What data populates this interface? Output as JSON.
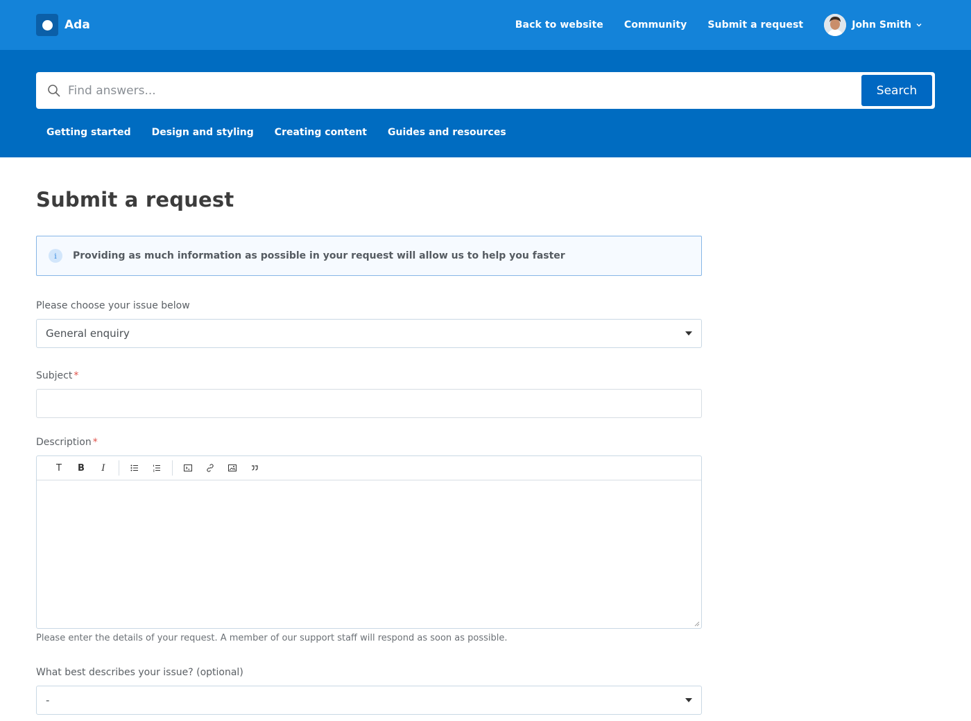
{
  "brand": {
    "name": "Ada"
  },
  "topnav": {
    "links": [
      "Back to website",
      "Community",
      "Submit a request"
    ],
    "user_name": "John Smith"
  },
  "search": {
    "placeholder": "Find answers...",
    "button_label": "Search"
  },
  "categories": [
    "Getting started",
    "Design and styling",
    "Creating content",
    "Guides and resources"
  ],
  "page": {
    "title": "Submit a request"
  },
  "notice": {
    "text": "Providing as much information as possible in your request will allow us to help you faster",
    "icon": "info-icon"
  },
  "form": {
    "issue": {
      "label": "Please choose your issue below",
      "value": "General enquiry"
    },
    "subject": {
      "label": "Subject",
      "required": "*",
      "value": ""
    },
    "description": {
      "label": "Description",
      "required": "*",
      "toolbar": [
        "text-icon",
        "bold-icon",
        "italic-icon",
        "bullet-list-icon",
        "numbered-list-icon",
        "code-block-icon",
        "link-icon",
        "image-icon",
        "quote-icon"
      ],
      "hint": "Please enter the details of your request. A member of our support staff will respond as soon as possible."
    },
    "issue_type": {
      "label": "What best describes your issue? (optional)",
      "value": "-"
    }
  },
  "colors": {
    "topbar": "#1483d9",
    "hero": "#006cc1",
    "button": "#0068c2",
    "required": "#e0524a"
  }
}
